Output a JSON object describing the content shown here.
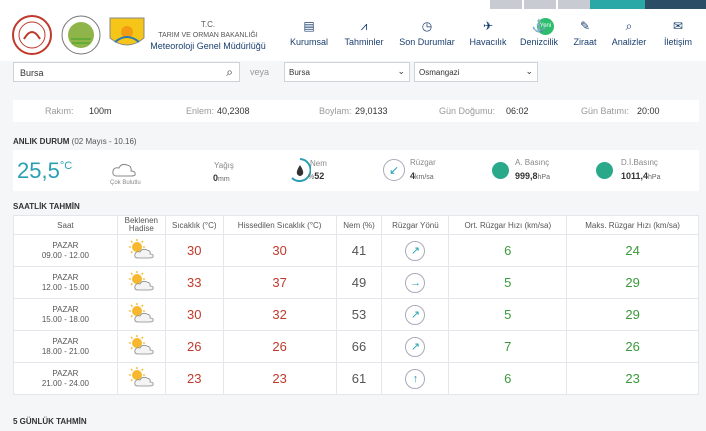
{
  "ministry": {
    "line1": "T.C.",
    "line2": "TARIM VE ORMAN BAKANLIĞI",
    "line3": "Meteoroloji Genel Müdürlüğü"
  },
  "nav": [
    {
      "label": "Kurumsal",
      "icon": "building-icon"
    },
    {
      "label": "Tahminler",
      "icon": "chart-icon"
    },
    {
      "label": "Son Durumlar",
      "icon": "clock-icon"
    },
    {
      "label": "Havacılık",
      "icon": "plane-icon"
    },
    {
      "label": "Denizcilik",
      "icon": "ship-icon"
    },
    {
      "label": "Ziraat",
      "icon": "leaf-icon"
    },
    {
      "label": "Analizler",
      "icon": "analysis-icon"
    },
    {
      "label": "İletişim",
      "icon": "mail-icon"
    }
  ],
  "nav_badge": "Yeni",
  "search": {
    "value": "Bursa",
    "veya": "veya"
  },
  "selects": {
    "province": "Bursa",
    "district": "Osmangazi"
  },
  "info": {
    "rakim_label": "Rakım:",
    "rakim": "100m",
    "enlem_label": "Enlem:",
    "enlem": "40,2308",
    "boylam_label": "Boylam:",
    "boylam": "29,0133",
    "gundogumu_label": "Gün Doğumu:",
    "gundogumu": "06:02",
    "gunbatimi_label": "Gün Batımı:",
    "gunbatimi": "20:00"
  },
  "current": {
    "title": "ANLIK DURUM",
    "subtitle": "(02 Mayıs - 10.16)",
    "temp": "25,5",
    "unit": "°C",
    "condition": "Çok Bulutlu",
    "yagis_label": "Yağış",
    "yagis": "0",
    "yagis_unit": "mm",
    "nem_label": "Nem",
    "nem": "52",
    "nem_prefix": "%",
    "ruzgar_label": "Rüzgar",
    "ruzgar": "4",
    "ruzgar_unit": "km/sa",
    "abasinc_label": "A. Basınç",
    "abasinc": "999,8",
    "abasinc_unit": "hPa",
    "dibasinc_label": "D.İ.Basınç",
    "dibasinc": "1011,4",
    "dibasinc_unit": "hPa"
  },
  "hourly": {
    "title": "SAATLİK TAHMİN",
    "headers": [
      "Saat",
      "Beklenen Hadise",
      "Sıcaklık (°C)",
      "Hissedilen Sıcaklık (°C)",
      "Nem (%)",
      "Rüzgar Yönü",
      "Ort. Rüzgar Hızı (km/sa)",
      "Maks. Rüzgar Hızı (km/sa)"
    ],
    "rows": [
      {
        "day": "PAZAR",
        "time": "09.00 - 12.00",
        "temp": "30",
        "feels": "30",
        "humidity": "41",
        "dir": "↗",
        "avg": "6",
        "max": "24"
      },
      {
        "day": "PAZAR",
        "time": "12.00 - 15.00",
        "temp": "33",
        "feels": "37",
        "humidity": "49",
        "dir": "→",
        "avg": "5",
        "max": "29"
      },
      {
        "day": "PAZAR",
        "time": "15.00 - 18.00",
        "temp": "30",
        "feels": "32",
        "humidity": "53",
        "dir": "↗",
        "avg": "5",
        "max": "29"
      },
      {
        "day": "PAZAR",
        "time": "18.00 - 21.00",
        "temp": "26",
        "feels": "26",
        "humidity": "66",
        "dir": "↗",
        "avg": "7",
        "max": "26"
      },
      {
        "day": "PAZAR",
        "time": "21.00 - 24.00",
        "temp": "23",
        "feels": "23",
        "humidity": "61",
        "dir": "↑",
        "avg": "6",
        "max": "23"
      }
    ]
  },
  "fiveday": {
    "title": "5 GÜNLÜK TAHMİN"
  },
  "colors": {
    "accent": "#2a9fb4",
    "temp_red": "#c0392b",
    "wind_green": "#3a9a3a",
    "navy": "#1a3e6e",
    "pressure": "#2aa88a"
  }
}
